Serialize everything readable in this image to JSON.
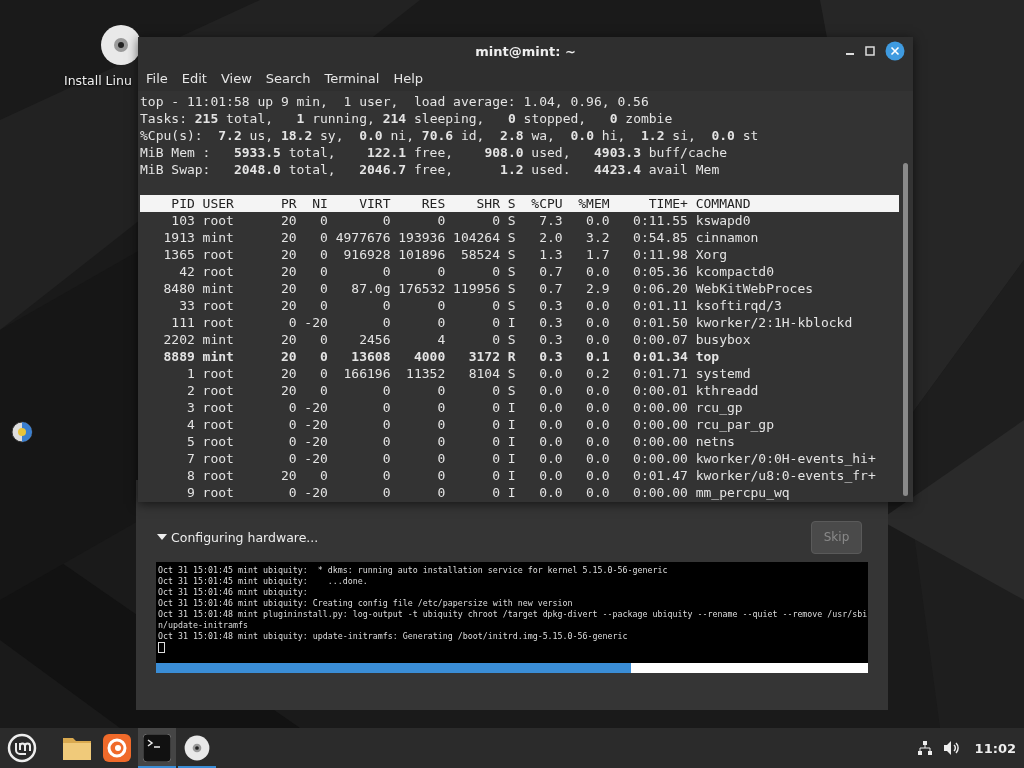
{
  "desktop": {
    "icons": [
      {
        "kind": "disc",
        "label": "Install Linu"
      },
      {
        "kind": "round"
      }
    ]
  },
  "terminal": {
    "title": "mint@mint: ~",
    "menu": [
      "File",
      "Edit",
      "View",
      "Search",
      "Terminal",
      "Help"
    ],
    "summary": [
      "top - 11:01:58 up 9 min,  1 user,  load average: 1.04, 0.96, 0.56",
      "Tasks: **215** total,   **1** running, **214** sleeping,   **0** stopped,   **0** zombie",
      "%Cpu(s):  **7.2** us, **18.2** sy,  **0.0** ni, **70.6** id,  **2.8** wa,  **0.0** hi,  **1.2** si,  **0.0** st",
      "MiB Mem :   **5933.5** total,    **122.1** free,    **908.0** used,   **4903.3** buff/cache",
      "MiB Swap:   **2048.0** total,   **2046.7** free,      **1.2** used.   **4423.4** avail Mem"
    ],
    "header": "    PID USER      PR  NI    VIRT    RES    SHR S  %CPU  %MEM     TIME+ COMMAND",
    "rows": [
      {
        "text": "    103 root      20   0       0      0      0 S   7.3   0.0   0:11.55 kswapd0",
        "bold": false
      },
      {
        "text": "   1913 mint      20   0 4977676 193936 104264 S   2.0   3.2   0:54.85 cinnamon",
        "bold": false
      },
      {
        "text": "   1365 root      20   0  916928 101896  58524 S   1.3   1.7   0:11.98 Xorg",
        "bold": false
      },
      {
        "text": "     42 root      20   0       0      0      0 S   0.7   0.0   0:05.36 kcompactd0",
        "bold": false
      },
      {
        "text": "   8480 mint      20   0   87.0g 176532 119956 S   0.7   2.9   0:06.20 WebKitWebProces",
        "bold": false
      },
      {
        "text": "     33 root      20   0       0      0      0 S   0.3   0.0   0:01.11 ksoftirqd/3",
        "bold": false
      },
      {
        "text": "    111 root       0 -20       0      0      0 I   0.3   0.0   0:01.50 kworker/2:1H-kblockd",
        "bold": false
      },
      {
        "text": "   2202 mint      20   0    2456      4      0 S   0.3   0.0   0:00.07 busybox",
        "bold": false
      },
      {
        "text": "   8889 mint      20   0   13608   4000   3172 R   0.3   0.1   0:01.34 top",
        "bold": true
      },
      {
        "text": "      1 root      20   0  166196  11352   8104 S   0.0   0.2   0:01.71 systemd",
        "bold": false
      },
      {
        "text": "      2 root      20   0       0      0      0 S   0.0   0.0   0:00.01 kthreadd",
        "bold": false
      },
      {
        "text": "      3 root       0 -20       0      0      0 I   0.0   0.0   0:00.00 rcu_gp",
        "bold": false
      },
      {
        "text": "      4 root       0 -20       0      0      0 I   0.0   0.0   0:00.00 rcu_par_gp",
        "bold": false
      },
      {
        "text": "      5 root       0 -20       0      0      0 I   0.0   0.0   0:00.00 netns",
        "bold": false
      },
      {
        "text": "      7 root       0 -20       0      0      0 I   0.0   0.0   0:00.00 kworker/0:0H-events_hi+",
        "bold": false
      },
      {
        "text": "      8 root      20   0       0      0      0 I   0.0   0.0   0:01.47 kworker/u8:0-events_fr+",
        "bold": false
      },
      {
        "text": "      9 root       0 -20       0      0      0 I   0.0   0.0   0:00.00 mm_percpu_wq",
        "bold": false
      }
    ]
  },
  "installer": {
    "status": "Configuring hardware...",
    "expanded": true,
    "skip": {
      "label": "Skip",
      "disabled": true
    },
    "log": [
      "Oct 31 15:01:45 mint ubiquity:  * dkms: running auto installation service for kernel 5.15.0-56-generic",
      "Oct 31 15:01:45 mint ubiquity:    ...done.",
      "Oct 31 15:01:46 mint ubiquity:",
      "Oct 31 15:01:46 mint ubiquity: Creating config file /etc/papersize with new version",
      "Oct 31 15:01:48 mint plugininstall.py: log-output -t ubiquity chroot /target dpkg-divert --package ubiquity --rename --quiet --remove /usr/sbi",
      "n/update-initramfs",
      "Oct 31 15:01:48 mint ubiquity: update-initramfs: Generating /boot/initrd.img-5.15.0-56-generic"
    ],
    "progress": {
      "level": 0.667
    }
  },
  "taskbar": {
    "items": [
      {
        "kind": "folder",
        "open": false,
        "selected": false
      },
      {
        "kind": "browser",
        "open": false,
        "selected": false
      },
      {
        "kind": "terminal",
        "open": true,
        "selected": true
      },
      {
        "kind": "disc",
        "open": true,
        "selected": false
      }
    ],
    "clock": "11:02"
  }
}
